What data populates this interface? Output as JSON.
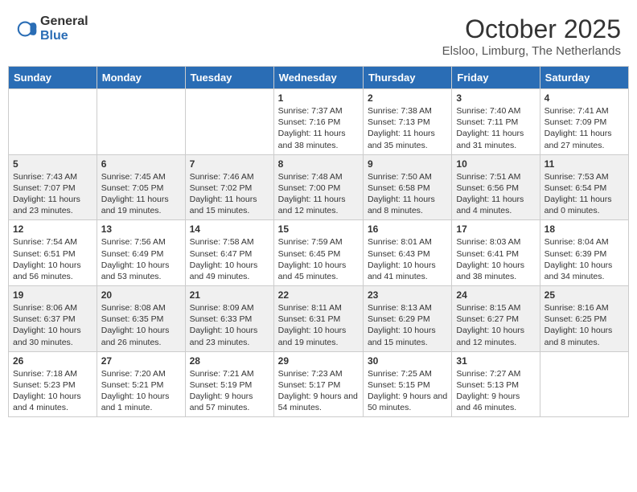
{
  "header": {
    "logo_general": "General",
    "logo_blue": "Blue",
    "month_title": "October 2025",
    "subtitle": "Elsloo, Limburg, The Netherlands"
  },
  "weekdays": [
    "Sunday",
    "Monday",
    "Tuesday",
    "Wednesday",
    "Thursday",
    "Friday",
    "Saturday"
  ],
  "weeks": [
    [
      {
        "day": "",
        "info": ""
      },
      {
        "day": "",
        "info": ""
      },
      {
        "day": "",
        "info": ""
      },
      {
        "day": "1",
        "info": "Sunrise: 7:37 AM\nSunset: 7:16 PM\nDaylight: 11 hours and 38 minutes."
      },
      {
        "day": "2",
        "info": "Sunrise: 7:38 AM\nSunset: 7:13 PM\nDaylight: 11 hours and 35 minutes."
      },
      {
        "day": "3",
        "info": "Sunrise: 7:40 AM\nSunset: 7:11 PM\nDaylight: 11 hours and 31 minutes."
      },
      {
        "day": "4",
        "info": "Sunrise: 7:41 AM\nSunset: 7:09 PM\nDaylight: 11 hours and 27 minutes."
      }
    ],
    [
      {
        "day": "5",
        "info": "Sunrise: 7:43 AM\nSunset: 7:07 PM\nDaylight: 11 hours and 23 minutes."
      },
      {
        "day": "6",
        "info": "Sunrise: 7:45 AM\nSunset: 7:05 PM\nDaylight: 11 hours and 19 minutes."
      },
      {
        "day": "7",
        "info": "Sunrise: 7:46 AM\nSunset: 7:02 PM\nDaylight: 11 hours and 15 minutes."
      },
      {
        "day": "8",
        "info": "Sunrise: 7:48 AM\nSunset: 7:00 PM\nDaylight: 11 hours and 12 minutes."
      },
      {
        "day": "9",
        "info": "Sunrise: 7:50 AM\nSunset: 6:58 PM\nDaylight: 11 hours and 8 minutes."
      },
      {
        "day": "10",
        "info": "Sunrise: 7:51 AM\nSunset: 6:56 PM\nDaylight: 11 hours and 4 minutes."
      },
      {
        "day": "11",
        "info": "Sunrise: 7:53 AM\nSunset: 6:54 PM\nDaylight: 11 hours and 0 minutes."
      }
    ],
    [
      {
        "day": "12",
        "info": "Sunrise: 7:54 AM\nSunset: 6:51 PM\nDaylight: 10 hours and 56 minutes."
      },
      {
        "day": "13",
        "info": "Sunrise: 7:56 AM\nSunset: 6:49 PM\nDaylight: 10 hours and 53 minutes."
      },
      {
        "day": "14",
        "info": "Sunrise: 7:58 AM\nSunset: 6:47 PM\nDaylight: 10 hours and 49 minutes."
      },
      {
        "day": "15",
        "info": "Sunrise: 7:59 AM\nSunset: 6:45 PM\nDaylight: 10 hours and 45 minutes."
      },
      {
        "day": "16",
        "info": "Sunrise: 8:01 AM\nSunset: 6:43 PM\nDaylight: 10 hours and 41 minutes."
      },
      {
        "day": "17",
        "info": "Sunrise: 8:03 AM\nSunset: 6:41 PM\nDaylight: 10 hours and 38 minutes."
      },
      {
        "day": "18",
        "info": "Sunrise: 8:04 AM\nSunset: 6:39 PM\nDaylight: 10 hours and 34 minutes."
      }
    ],
    [
      {
        "day": "19",
        "info": "Sunrise: 8:06 AM\nSunset: 6:37 PM\nDaylight: 10 hours and 30 minutes."
      },
      {
        "day": "20",
        "info": "Sunrise: 8:08 AM\nSunset: 6:35 PM\nDaylight: 10 hours and 26 minutes."
      },
      {
        "day": "21",
        "info": "Sunrise: 8:09 AM\nSunset: 6:33 PM\nDaylight: 10 hours and 23 minutes."
      },
      {
        "day": "22",
        "info": "Sunrise: 8:11 AM\nSunset: 6:31 PM\nDaylight: 10 hours and 19 minutes."
      },
      {
        "day": "23",
        "info": "Sunrise: 8:13 AM\nSunset: 6:29 PM\nDaylight: 10 hours and 15 minutes."
      },
      {
        "day": "24",
        "info": "Sunrise: 8:15 AM\nSunset: 6:27 PM\nDaylight: 10 hours and 12 minutes."
      },
      {
        "day": "25",
        "info": "Sunrise: 8:16 AM\nSunset: 6:25 PM\nDaylight: 10 hours and 8 minutes."
      }
    ],
    [
      {
        "day": "26",
        "info": "Sunrise: 7:18 AM\nSunset: 5:23 PM\nDaylight: 10 hours and 4 minutes."
      },
      {
        "day": "27",
        "info": "Sunrise: 7:20 AM\nSunset: 5:21 PM\nDaylight: 10 hours and 1 minute."
      },
      {
        "day": "28",
        "info": "Sunrise: 7:21 AM\nSunset: 5:19 PM\nDaylight: 9 hours and 57 minutes."
      },
      {
        "day": "29",
        "info": "Sunrise: 7:23 AM\nSunset: 5:17 PM\nDaylight: 9 hours and 54 minutes."
      },
      {
        "day": "30",
        "info": "Sunrise: 7:25 AM\nSunset: 5:15 PM\nDaylight: 9 hours and 50 minutes."
      },
      {
        "day": "31",
        "info": "Sunrise: 7:27 AM\nSunset: 5:13 PM\nDaylight: 9 hours and 46 minutes."
      },
      {
        "day": "",
        "info": ""
      }
    ]
  ]
}
